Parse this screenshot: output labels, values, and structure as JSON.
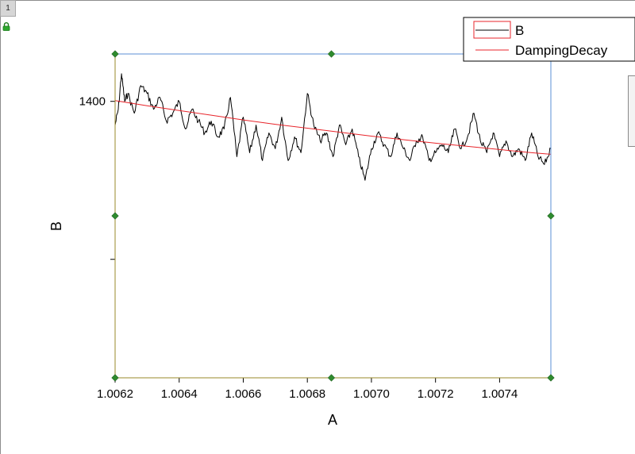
{
  "window": {
    "layer_tab": "1"
  },
  "chart_data": {
    "type": "line",
    "xlabel": "A",
    "ylabel": "B",
    "xlim": [
      1.0062,
      1.00756
    ],
    "ylim": [
      1330,
      1412
    ],
    "x_ticks": [
      {
        "value": 1.0062,
        "label": "1.0062"
      },
      {
        "value": 1.0064,
        "label": "1.0064"
      },
      {
        "value": 1.0066,
        "label": "1.0066"
      },
      {
        "value": 1.0068,
        "label": "1.0068"
      },
      {
        "value": 1.007,
        "label": "1.0070"
      },
      {
        "value": 1.0072,
        "label": "1.0072"
      },
      {
        "value": 1.0074,
        "label": "1.0074"
      }
    ],
    "y_ticks": [
      {
        "value": 1400,
        "label": "1400"
      },
      {
        "value": 1360,
        "label": ""
      }
    ],
    "legend": {
      "placement": "top-right",
      "entries": [
        "B",
        "DampingDecay"
      ]
    },
    "series": [
      {
        "name": "B",
        "color": "#000000",
        "x": [
          1.0062,
          1.00621,
          1.00622,
          1.00623,
          1.00624,
          1.00626,
          1.00628,
          1.0063,
          1.00632,
          1.00634,
          1.00636,
          1.00638,
          1.0064,
          1.00642,
          1.00644,
          1.00646,
          1.00648,
          1.0065,
          1.00652,
          1.00654,
          1.00656,
          1.00658,
          1.0066,
          1.00662,
          1.00664,
          1.00666,
          1.00668,
          1.0067,
          1.00672,
          1.00674,
          1.00676,
          1.00678,
          1.0068,
          1.00682,
          1.00684,
          1.00686,
          1.00688,
          1.0069,
          1.00692,
          1.00694,
          1.00696,
          1.00698,
          1.007,
          1.00702,
          1.00704,
          1.00706,
          1.00708,
          1.0071,
          1.00712,
          1.00714,
          1.00716,
          1.00718,
          1.0072,
          1.00722,
          1.00724,
          1.00726,
          1.00728,
          1.0073,
          1.00732,
          1.00734,
          1.00736,
          1.00738,
          1.0074,
          1.00742,
          1.00744,
          1.00746,
          1.00748,
          1.0075,
          1.00752,
          1.00754,
          1.00756
        ],
        "y": [
          1394,
          1398,
          1407,
          1400,
          1402,
          1397,
          1404,
          1402,
          1398,
          1401,
          1395,
          1397,
          1400,
          1393,
          1398,
          1395,
          1392,
          1395,
          1391,
          1393,
          1401,
          1386,
          1396,
          1387,
          1394,
          1385,
          1392,
          1388,
          1396,
          1385,
          1391,
          1387,
          1402,
          1394,
          1390,
          1392,
          1386,
          1394,
          1389,
          1393,
          1386,
          1380,
          1388,
          1392,
          1389,
          1386,
          1392,
          1388,
          1385,
          1390,
          1391,
          1385,
          1387,
          1389,
          1387,
          1393,
          1388,
          1391,
          1397,
          1390,
          1387,
          1392,
          1386,
          1390,
          1386,
          1388,
          1385,
          1392,
          1386,
          1384,
          1388
        ]
      },
      {
        "name": "DampingDecay",
        "color": "#e8252b",
        "x": [
          1.0062,
          1.0063,
          1.0064,
          1.0065,
          1.0066,
          1.0067,
          1.0068,
          1.0069,
          1.007,
          1.0071,
          1.0072,
          1.0073,
          1.0074,
          1.0075,
          1.00756
        ],
        "y": [
          1400.2,
          1398.9,
          1397.7,
          1396.5,
          1395.3,
          1394.2,
          1393.2,
          1392.2,
          1391.2,
          1390.3,
          1389.4,
          1388.6,
          1387.8,
          1387.0,
          1386.6
        ]
      }
    ]
  }
}
